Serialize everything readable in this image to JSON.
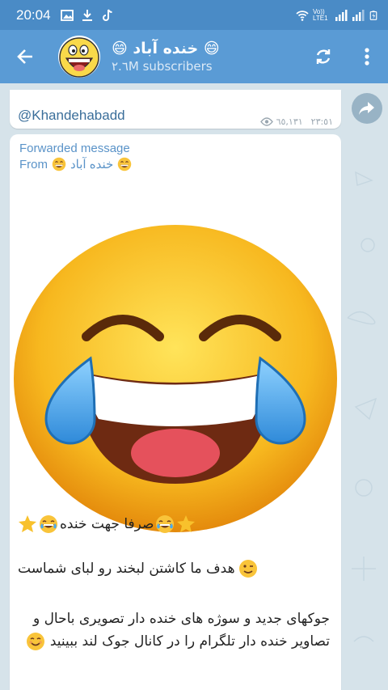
{
  "status_bar": {
    "time": "20:04",
    "network_label": "Vo)) LTE1"
  },
  "header": {
    "channel_title": "😄 خنده آباد 😄",
    "subscribers": "۲.٦M subscribers"
  },
  "pinned_card": {
    "handle": "@Khandehabadd",
    "views": "٦٥,١٣١",
    "time": "٢٣:٥١"
  },
  "message": {
    "forwarded_label": "Forwarded message",
    "from_label": "From",
    "from_channel": "خنده آباد",
    "caption_line1": "صرفا جهت خنده",
    "caption_line2": "هدف ما کاشتن لبخند رو لبای شماست",
    "caption_line3": "جوکهای جدید و سوژه های خنده دار تصویری باحال و تصاویر خنده دار تلگرام  را در کانال جوک لند ببینید"
  },
  "colors": {
    "appbar": "#5a9bd5",
    "statusbar": "#4a8bc6",
    "link": "#5a93c8",
    "chat_bg": "#d6e3ea"
  },
  "icons": [
    "back-arrow-icon",
    "refresh-icon",
    "more-vertical-icon",
    "eye-icon",
    "share-icon",
    "star-icon",
    "laughing-emoji-icon",
    "wink-emoji-icon",
    "smile-emoji-icon",
    "grinning-emoji-icon"
  ]
}
